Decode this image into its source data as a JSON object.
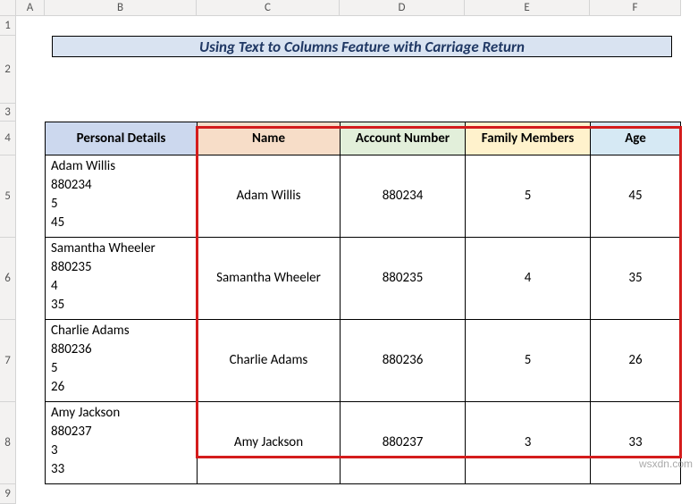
{
  "columns": [
    "A",
    "B",
    "C",
    "D",
    "E",
    "F"
  ],
  "row_numbers": [
    1,
    2,
    3,
    4,
    5,
    6,
    7,
    8,
    9
  ],
  "title": "Using Text to Columns Feature with Carriage Return",
  "headers": {
    "personal": "Personal Details",
    "name": "Name",
    "account": "Account Number",
    "family": "Family Members",
    "age": "Age"
  },
  "rows": [
    {
      "raw": [
        "Adam Willis",
        "880234",
        "5",
        "45"
      ],
      "name": "Adam Willis",
      "account": "880234",
      "family": "5",
      "age": "45"
    },
    {
      "raw": [
        "Samantha Wheeler",
        "880235",
        "4",
        "35"
      ],
      "name": "Samantha Wheeler",
      "account": "880235",
      "family": "4",
      "age": "35"
    },
    {
      "raw": [
        "Charlie Adams",
        "880236",
        "5",
        "26"
      ],
      "name": "Charlie Adams",
      "account": "880236",
      "family": "5",
      "age": "26"
    },
    {
      "raw": [
        "Amy Jackson",
        "880237",
        "3",
        "33"
      ],
      "name": "Amy Jackson",
      "account": "880237",
      "family": "3",
      "age": "33"
    }
  ],
  "watermark": "wsxdn.com",
  "chart_data": {
    "type": "table",
    "title": "Using Text to Columns Feature with Carriage Return",
    "columns": [
      "Personal Details",
      "Name",
      "Account Number",
      "Family Members",
      "Age"
    ],
    "data": [
      [
        "Adam Willis\n880234\n5\n45",
        "Adam Willis",
        "880234",
        "5",
        "45"
      ],
      [
        "Samantha Wheeler\n880235\n4\n35",
        "Samantha Wheeler",
        "880235",
        "4",
        "35"
      ],
      [
        "Charlie Adams\n880236\n5\n26",
        "Charlie Adams",
        "880236",
        "5",
        "26"
      ],
      [
        "Amy Jackson\n880237\n3\n33",
        "Amy Jackson",
        "880237",
        "3",
        "33"
      ]
    ]
  }
}
